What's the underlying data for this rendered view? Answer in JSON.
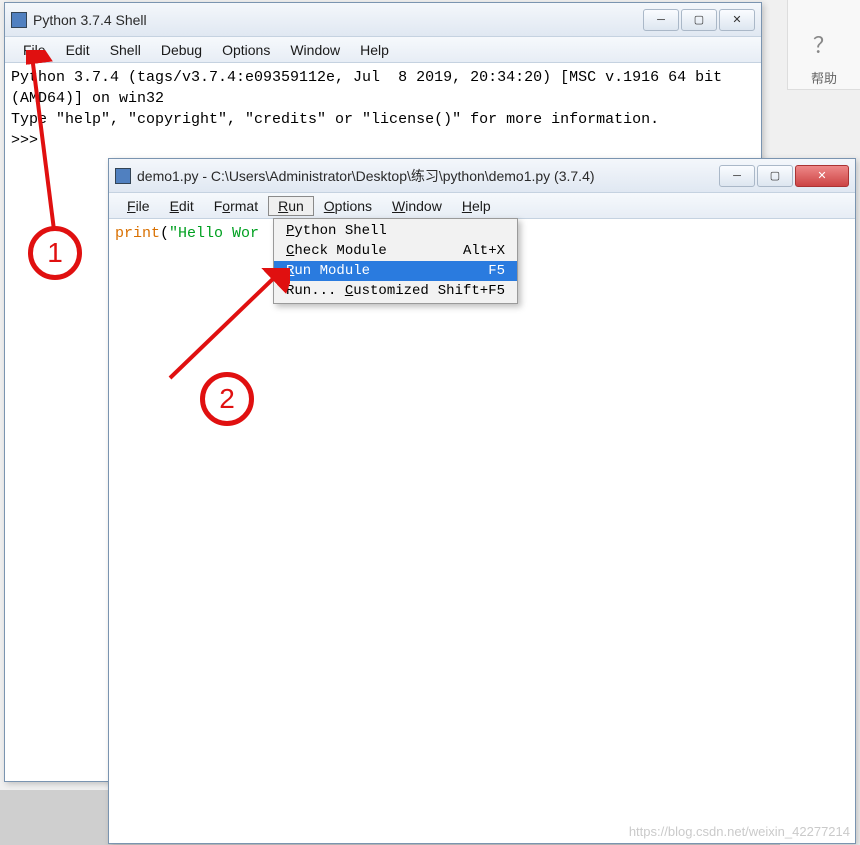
{
  "help_panel": {
    "label": "帮助"
  },
  "shell_window": {
    "title": "Python 3.7.4 Shell",
    "menubar": [
      "File",
      "Edit",
      "Shell",
      "Debug",
      "Options",
      "Window",
      "Help"
    ],
    "content_line1": "Python 3.7.4 (tags/v3.7.4:e09359112e, Jul  8 2019, 20:34:20) [MSC v.1916 64 bit ",
    "content_line2": "(AMD64)] on win32",
    "content_line3": "Type \"help\", \"copyright\", \"credits\" or \"license()\" for more information.",
    "prompt": ">>> "
  },
  "editor_window": {
    "title": "demo1.py - C:\\Users\\Administrator\\Desktop\\练习\\python\\demo1.py (3.7.4)",
    "menubar": [
      "File",
      "Edit",
      "Format",
      "Run",
      "Options",
      "Window",
      "Help"
    ],
    "code_keyword": "print",
    "code_paren_open": "(",
    "code_string": "\"Hello Wor",
    "run_menu": {
      "items": [
        {
          "label": "Python Shell",
          "shortcut": "",
          "underline": 0
        },
        {
          "label": "Check Module",
          "shortcut": "Alt+X",
          "underline": 0
        },
        {
          "label": "Run Module",
          "shortcut": "F5",
          "underline": 0,
          "selected": true
        },
        {
          "label": "Run... Customized",
          "shortcut": "Shift+F5",
          "underline_pos": "C"
        }
      ]
    }
  },
  "annotations": {
    "circle1": "1",
    "circle2": "2"
  },
  "watermark": "https://blog.csdn.net/weixin_42277214"
}
